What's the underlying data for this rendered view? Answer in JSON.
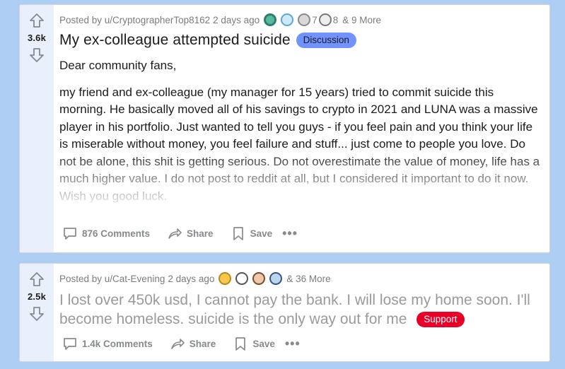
{
  "posts": [
    {
      "votes": "3.6k",
      "posted_by": "Posted by u/CryptographerTop8162",
      "age": "2 days ago",
      "award_count_a": "7",
      "award_count_b": "8",
      "more_awards": "& 9 More",
      "title": "My ex-colleague attempted suicide",
      "flair": "Discussion",
      "flair_color": "#7193ff",
      "body": [
        "Dear community fans,",
        "my friend and ex-colleague (my manager for 15 years) tried to commit suicide this morning. He basically moved all of his savings to crypto in 2021 and LUNA was a massive player in his portfolio. Just wanted to tell you guys - if you feel pain and you think your life is miserable without money, you feel failure and stuff... just come to people you love. Do not be alone, this shit is getting serious. Do not overestimate the value of money, life has a much higher value. I do not post to reddit at all, but I considered it important to do it now. Wish you good luck."
      ],
      "comments": "876 Comments",
      "share": "Share",
      "save": "Save",
      "more": "•••"
    },
    {
      "votes": "2.5k",
      "posted_by": "Posted by u/Cat-Evening",
      "age": "2 days ago",
      "more_awards": "& 36 More",
      "title": "I lost over 450k usd, I cannot pay the bank. I will lose my home soon. I'll become homeless. suicide is the only way out for me",
      "flair": "Support",
      "flair_color": "#ea0027",
      "comments": "1.4k Comments",
      "share": "Share",
      "save": "Save",
      "more": "•••"
    }
  ]
}
